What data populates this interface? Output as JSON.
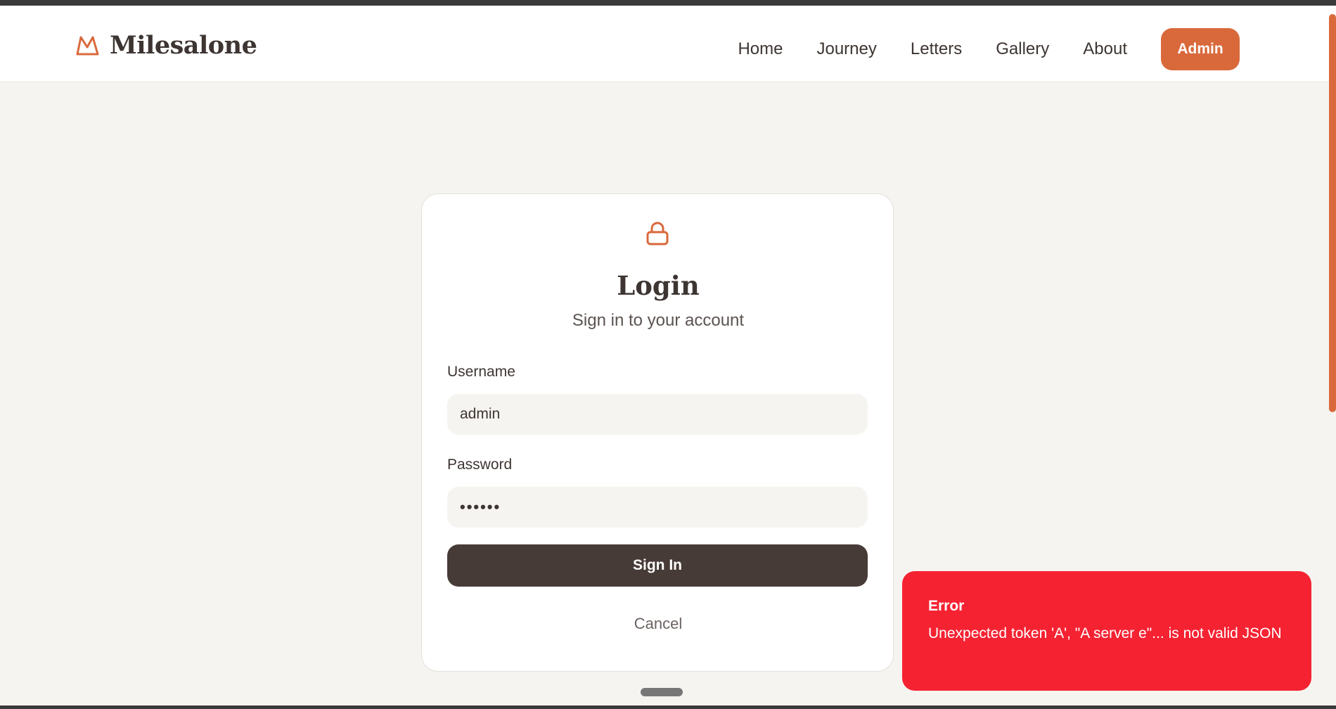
{
  "brand": {
    "name": "Milesalone",
    "accent": "#d9693b"
  },
  "nav": {
    "items": [
      {
        "label": "Home"
      },
      {
        "label": "Journey"
      },
      {
        "label": "Letters"
      },
      {
        "label": "Gallery"
      },
      {
        "label": "About"
      }
    ],
    "admin_label": "Admin"
  },
  "login": {
    "icon": "lock-icon",
    "title": "Login",
    "subtitle": "Sign in to your account",
    "username_label": "Username",
    "username_value": "admin",
    "password_label": "Password",
    "password_value": "••••••",
    "submit_label": "Sign In",
    "cancel_label": "Cancel"
  },
  "toast": {
    "title": "Error",
    "message": "Unexpected token 'A', \"A server e\"... is not valid JSON",
    "color": "#f52232"
  }
}
